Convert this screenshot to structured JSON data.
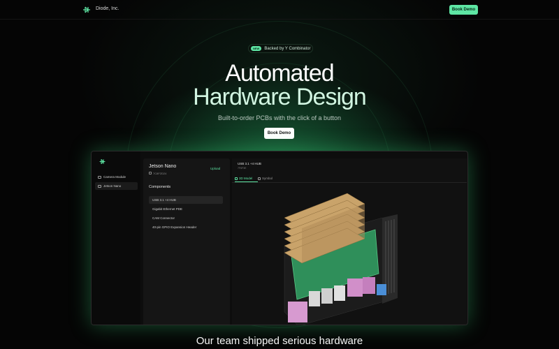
{
  "nav": {
    "brand": "Diode, Inc.",
    "cta": "Book Demo"
  },
  "hero": {
    "badge": "NEW",
    "announcement": "Backed by Y Combinator",
    "title_line1": "Automated",
    "title_line2": "Hardware Design",
    "subtitle": "Built-to-order PCBs with the click of a button",
    "cta": "Book Demo"
  },
  "app": {
    "sidebar": {
      "items": [
        {
          "label": "Camera Module"
        },
        {
          "label": "Jetson Nano",
          "active": true
        }
      ]
    },
    "project": {
      "title": "Jetson Nano",
      "id": "7C8F2D24",
      "upload": "Upload",
      "components_heading": "Components",
      "components": [
        {
          "label": "USB 3.1 +4 HUB",
          "active": true
        },
        {
          "label": "Gigabit Ethernet PDE"
        },
        {
          "label": "CAM Connector"
        },
        {
          "label": "40-pin GPIO Expansion Header"
        }
      ]
    },
    "viewer": {
      "title": "USB 3.1 +4 HUB",
      "subtitle": "7F6F3E",
      "tabs": [
        {
          "label": "3D Model",
          "active": true
        },
        {
          "label": "Symbol"
        }
      ]
    }
  },
  "section": {
    "heading": "Our team shipped serious hardware"
  },
  "colors": {
    "accent": "#5ee6a4",
    "background": "#050505",
    "panel": "#151515"
  },
  "icons": [
    "diode-logo-icon",
    "folder-icon",
    "id-icon",
    "cube-icon",
    "symbol-icon"
  ]
}
